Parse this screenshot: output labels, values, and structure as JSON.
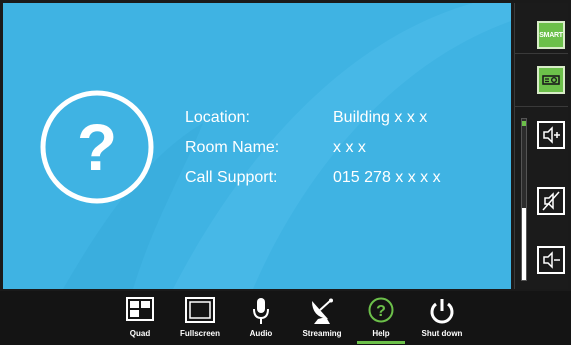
{
  "info": {
    "location_label": "Location:",
    "location_value": "Building x x x",
    "room_label": "Room Name:",
    "room_value": "x x x",
    "support_label": "Call Support:",
    "support_value": "015 278 x x x x"
  },
  "rail": {
    "smart_label": "SMART",
    "volume_level_percent": 45
  },
  "toolbar": {
    "quad": "Quad",
    "fullscreen": "Fullscreen",
    "audio": "Audio",
    "streaming": "Streaming",
    "help": "Help",
    "shutdown": "Shut down",
    "active": "help"
  },
  "colors": {
    "panel_blue": "#3fb3e3",
    "accent_green": "#6cc04a",
    "toolbar_bg": "#141414"
  },
  "icons": [
    "help-icon",
    "smart-logo-icon",
    "projector-icon",
    "volume-up-icon",
    "mute-icon",
    "volume-down-icon",
    "quad-icon",
    "fullscreen-icon",
    "microphone-icon",
    "satellite-dish-icon",
    "help-circle-icon",
    "power-icon"
  ]
}
